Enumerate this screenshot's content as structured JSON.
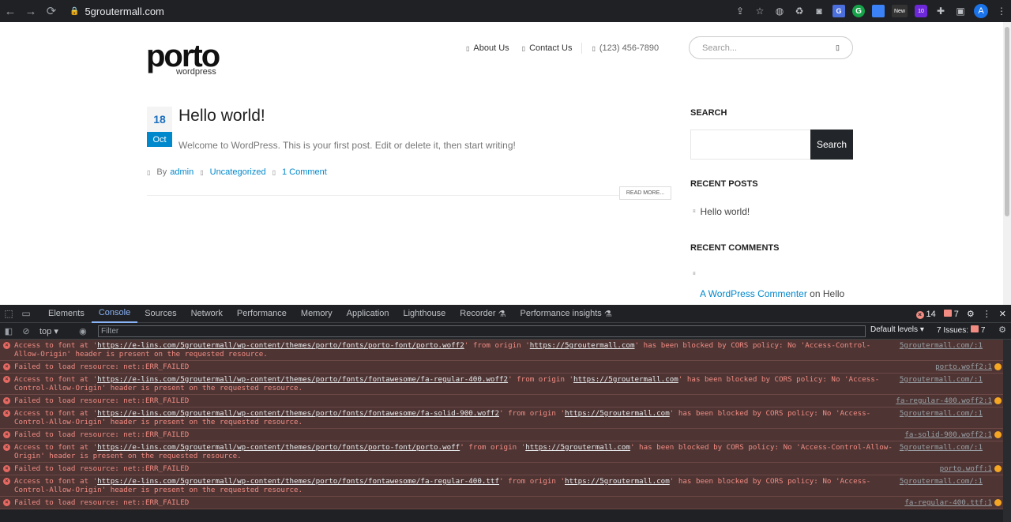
{
  "browser": {
    "url": "5groutermall.com",
    "extensions": [
      "share-icon",
      "star-icon",
      "globe-icon",
      "recycle-icon",
      "camera-icon",
      "translate-icon",
      "grammarly-icon",
      "docs-icon",
      "new-extension-icon",
      "badge-extension-icon",
      "puzzle-icon",
      "sidebar-icon"
    ],
    "new_label": "New",
    "badge_count": "10",
    "avatar_letter": "A"
  },
  "site": {
    "logo_text": "porto",
    "logo_sub": "wordpress",
    "nav": {
      "about": "About Us",
      "contact": "Contact Us",
      "phone": "(123) 456-7890"
    },
    "search_placeholder": "Search..."
  },
  "post": {
    "day": "18",
    "month": "Oct",
    "title": "Hello world!",
    "excerpt": "Welcome to WordPress. This is your first post. Edit or delete it, then start writing!",
    "by_label": "By",
    "author": "admin",
    "category": "Uncategorized",
    "comments": "1 Comment",
    "read_more": "READ MORE..."
  },
  "sidebar": {
    "search_heading": "SEARCH",
    "search_button": "Search",
    "recent_posts_heading": "RECENT POSTS",
    "recent_post_1": "Hello world!",
    "recent_comments_heading": "RECENT COMMENTS",
    "commenter": "A WordPress Commenter",
    "comment_on": "on Hello"
  },
  "devtools": {
    "tabs": [
      "Elements",
      "Console",
      "Sources",
      "Network",
      "Performance",
      "Memory",
      "Application",
      "Lighthouse",
      "Recorder",
      "Performance insights"
    ],
    "active_tab": "Console",
    "error_count": "14",
    "warning_count": "7",
    "context": "top",
    "filter_placeholder": "Filter",
    "levels": "Default levels",
    "issues_label": "7 Issues:",
    "issues_count": "7",
    "logs": [
      {
        "pre": "Access to font at '",
        "url": "https://e-lins.com/5groutermall/wp-content/themes/porto/fonts/porto-font/porto.woff2",
        "mid": "' from origin '",
        "origin": "https://5groutermall.com",
        "post": "' has been blocked by CORS policy: No 'Access-Control-Allow-Origin' header is present on the requested resource.",
        "source": "5groutermall.com/:1"
      },
      {
        "pre": "Failed to load resource: net::ERR_FAILED",
        "source": "porto.woff2:1"
      },
      {
        "pre": "Access to font at '",
        "url": "https://e-lins.com/5groutermall/wp-content/themes/porto/fonts/fontawesome/fa-regular-400.woff2",
        "mid": "' from origin '",
        "origin": "https://5groutermall.com",
        "post": "' has been blocked by CORS policy: No 'Access-Control-Allow-Origin' header is present on the requested resource.",
        "source": "5groutermall.com/:1"
      },
      {
        "pre": "Failed to load resource: net::ERR_FAILED",
        "source": "fa-regular-400.woff2:1"
      },
      {
        "pre": "Access to font at '",
        "url": "https://e-lins.com/5groutermall/wp-content/themes/porto/fonts/fontawesome/fa-solid-900.woff2",
        "mid": "' from origin '",
        "origin": "https://5groutermall.com",
        "post": "' has been blocked by CORS policy: No 'Access-Control-Allow-Origin' header is present on the requested resource.",
        "source": "5groutermall.com/:1"
      },
      {
        "pre": "Failed to load resource: net::ERR_FAILED",
        "source": "fa-solid-900.woff2:1"
      },
      {
        "pre": "Access to font at '",
        "url": "https://e-lins.com/5groutermall/wp-content/themes/porto/fonts/porto-font/porto.woff",
        "mid": "' from origin '",
        "origin": "https://5groutermall.com",
        "post": "' has been blocked by CORS policy: No 'Access-Control-Allow-Origin' header is present on the requested resource.",
        "source": "5groutermall.com/:1"
      },
      {
        "pre": "Failed to load resource: net::ERR_FAILED",
        "source": "porto.woff:1"
      },
      {
        "pre": "Access to font at '",
        "url": "https://e-lins.com/5groutermall/wp-content/themes/porto/fonts/fontawesome/fa-regular-400.ttf",
        "mid": "' from origin '",
        "origin": "https://5groutermall.com",
        "post": "' has been blocked by CORS policy: No 'Access-Control-Allow-Origin' header is present on the requested resource.",
        "source": "5groutermall.com/:1"
      },
      {
        "pre": "Failed to load resource: net::ERR_FAILED",
        "source": "fa-regular-400.ttf:1"
      }
    ]
  },
  "colors": {
    "accent": "#0088cc",
    "error_bg": "#4e3534",
    "error_text": "#f28b82",
    "devtools_bg": "#202124"
  }
}
